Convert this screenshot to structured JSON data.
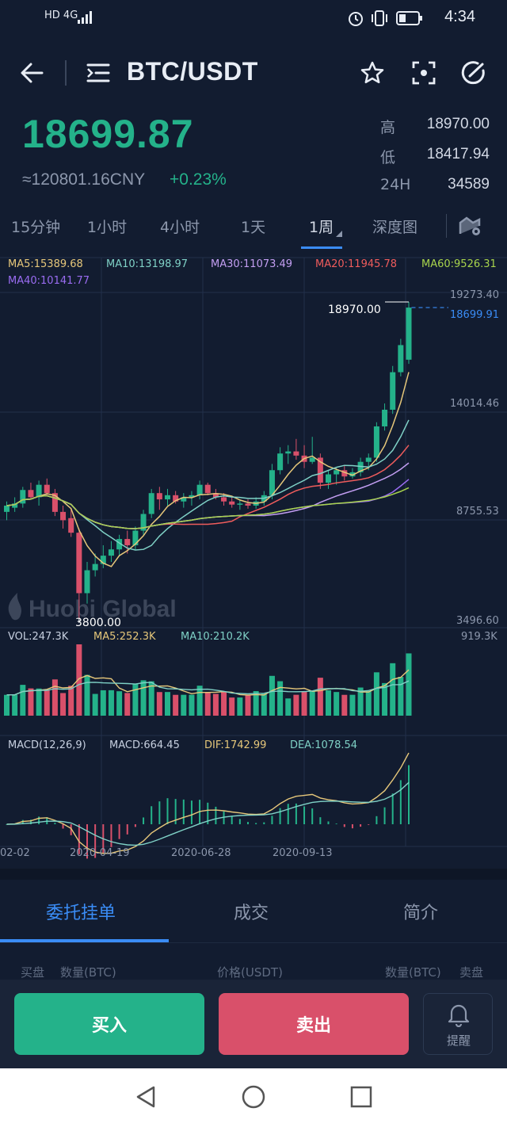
{
  "status_bar": {
    "network": "HD 4G",
    "time": "4:34"
  },
  "header": {
    "pair": "BTC/USDT"
  },
  "ticker": {
    "last_price": "18699.87",
    "cny": "≈120801.16CNY",
    "change": "+0.23%",
    "high_label": "高",
    "high": "18970.00",
    "low_label": "低",
    "low": "18417.94",
    "vol_label": "24H",
    "vol": "34589"
  },
  "timeframes": [
    "15分钟",
    "1小时",
    "4小时",
    "1天",
    "1周",
    "深度图"
  ],
  "active_timeframe": "1周",
  "ma_legend": {
    "ma5": "MA5:15389.68",
    "ma10": "MA10:13198.97",
    "ma30": "MA30:11073.49",
    "ma20": "MA20:11945.78",
    "ma60": "MA60:9526.31",
    "ma40": "MA40:10141.77"
  },
  "price_axis": [
    "19273.40",
    "14014.46",
    "8755.53",
    "3496.60"
  ],
  "current_price_tag": "18699.91",
  "high_marker": "18970.00",
  "low_marker": "3800.00",
  "watermark": "Huobi Global",
  "volume_legend": {
    "vol": "VOL:247.3K",
    "ma5": "MA5:252.3K",
    "ma10": "MA10:210.2K",
    "max": "919.3K"
  },
  "macd_legend": {
    "name": "MACD(12,26,9)",
    "macd": "MACD:664.45",
    "dif": "DIF:1742.99",
    "dea": "DEA:1078.54"
  },
  "date_axis": [
    "02-02",
    "2020-04-19",
    "2020-06-28",
    "2020-09-13"
  ],
  "bottom_tabs": [
    "委托挂单",
    "成交",
    "简介"
  ],
  "orderbook_header": {
    "buy": "买盘",
    "qty_left": "数量(BTC)",
    "price": "价格(USDT)",
    "qty_right": "数量(BTC)",
    "sell": "卖盘"
  },
  "actions": {
    "buy": "买入",
    "sell": "卖出",
    "alert": "提醒"
  },
  "colors": {
    "up": "#24b28a",
    "down": "#d9506a",
    "accent": "#3a8cf5",
    "bg": "#121c30"
  },
  "chart_data": {
    "type": "candlestick",
    "title": "",
    "y_range": [
      3496.6,
      19273.4
    ],
    "candles": [
      {
        "o": 8900,
        "h": 9400,
        "l": 8500,
        "c": 9200
      },
      {
        "o": 9100,
        "h": 9600,
        "l": 8900,
        "c": 9300
      },
      {
        "o": 9300,
        "h": 10100,
        "l": 9100,
        "c": 9950
      },
      {
        "o": 9950,
        "h": 10300,
        "l": 9500,
        "c": 9600
      },
      {
        "o": 9600,
        "h": 10400,
        "l": 9200,
        "c": 10200
      },
      {
        "o": 10200,
        "h": 10500,
        "l": 9700,
        "c": 9800
      },
      {
        "o": 9800,
        "h": 10000,
        "l": 8700,
        "c": 8900
      },
      {
        "o": 8900,
        "h": 9200,
        "l": 8100,
        "c": 8500
      },
      {
        "o": 8600,
        "h": 9100,
        "l": 7700,
        "c": 7900
      },
      {
        "o": 7900,
        "h": 8100,
        "l": 3800,
        "c": 5000
      },
      {
        "o": 5000,
        "h": 6500,
        "l": 4500,
        "c": 6100
      },
      {
        "o": 6100,
        "h": 6900,
        "l": 5800,
        "c": 6400
      },
      {
        "o": 6400,
        "h": 7300,
        "l": 6200,
        "c": 6800
      },
      {
        "o": 6800,
        "h": 7500,
        "l": 6500,
        "c": 7100
      },
      {
        "o": 7100,
        "h": 7800,
        "l": 6800,
        "c": 7600
      },
      {
        "o": 7600,
        "h": 8000,
        "l": 6900,
        "c": 7300
      },
      {
        "o": 7300,
        "h": 8200,
        "l": 7100,
        "c": 8000
      },
      {
        "o": 8000,
        "h": 9000,
        "l": 7800,
        "c": 8800
      },
      {
        "o": 8800,
        "h": 10000,
        "l": 8600,
        "c": 9800
      },
      {
        "o": 9800,
        "h": 10100,
        "l": 9000,
        "c": 9500
      },
      {
        "o": 9500,
        "h": 10000,
        "l": 9200,
        "c": 9700
      },
      {
        "o": 9700,
        "h": 9900,
        "l": 9300,
        "c": 9400
      },
      {
        "o": 9400,
        "h": 9800,
        "l": 9100,
        "c": 9600
      },
      {
        "o": 9600,
        "h": 9900,
        "l": 9200,
        "c": 9700
      },
      {
        "o": 9700,
        "h": 10400,
        "l": 9500,
        "c": 10200
      },
      {
        "o": 10200,
        "h": 10300,
        "l": 9700,
        "c": 9800
      },
      {
        "o": 9800,
        "h": 10000,
        "l": 9500,
        "c": 9600
      },
      {
        "o": 9600,
        "h": 9800,
        "l": 9200,
        "c": 9400
      },
      {
        "o": 9400,
        "h": 9600,
        "l": 9100,
        "c": 9250
      },
      {
        "o": 9250,
        "h": 9500,
        "l": 9000,
        "c": 9300
      },
      {
        "o": 9300,
        "h": 9500,
        "l": 9050,
        "c": 9200
      },
      {
        "o": 9200,
        "h": 9600,
        "l": 9050,
        "c": 9400
      },
      {
        "o": 9400,
        "h": 9900,
        "l": 9200,
        "c": 9700
      },
      {
        "o": 9700,
        "h": 11200,
        "l": 9500,
        "c": 10900
      },
      {
        "o": 10900,
        "h": 12000,
        "l": 10700,
        "c": 11700
      },
      {
        "o": 11700,
        "h": 12100,
        "l": 11200,
        "c": 11800
      },
      {
        "o": 11800,
        "h": 12400,
        "l": 11400,
        "c": 11600
      },
      {
        "o": 11600,
        "h": 12100,
        "l": 11000,
        "c": 11300
      },
      {
        "o": 11300,
        "h": 12500,
        "l": 11200,
        "c": 11500
      },
      {
        "o": 11500,
        "h": 11700,
        "l": 10000,
        "c": 10300
      },
      {
        "o": 10300,
        "h": 10900,
        "l": 10000,
        "c": 10700
      },
      {
        "o": 10700,
        "h": 11000,
        "l": 10200,
        "c": 10900
      },
      {
        "o": 10900,
        "h": 11100,
        "l": 10400,
        "c": 10600
      },
      {
        "o": 10600,
        "h": 11000,
        "l": 10500,
        "c": 10800
      },
      {
        "o": 10800,
        "h": 11500,
        "l": 10600,
        "c": 11300
      },
      {
        "o": 11300,
        "h": 11700,
        "l": 10900,
        "c": 11500
      },
      {
        "o": 11500,
        "h": 13200,
        "l": 11300,
        "c": 13000
      },
      {
        "o": 13000,
        "h": 14100,
        "l": 12800,
        "c": 13800
      },
      {
        "o": 13800,
        "h": 15900,
        "l": 13600,
        "c": 15600
      },
      {
        "o": 15600,
        "h": 17200,
        "l": 15400,
        "c": 16900
      },
      {
        "o": 16200,
        "h": 18970,
        "l": 16000,
        "c": 18699.87
      }
    ]
  }
}
